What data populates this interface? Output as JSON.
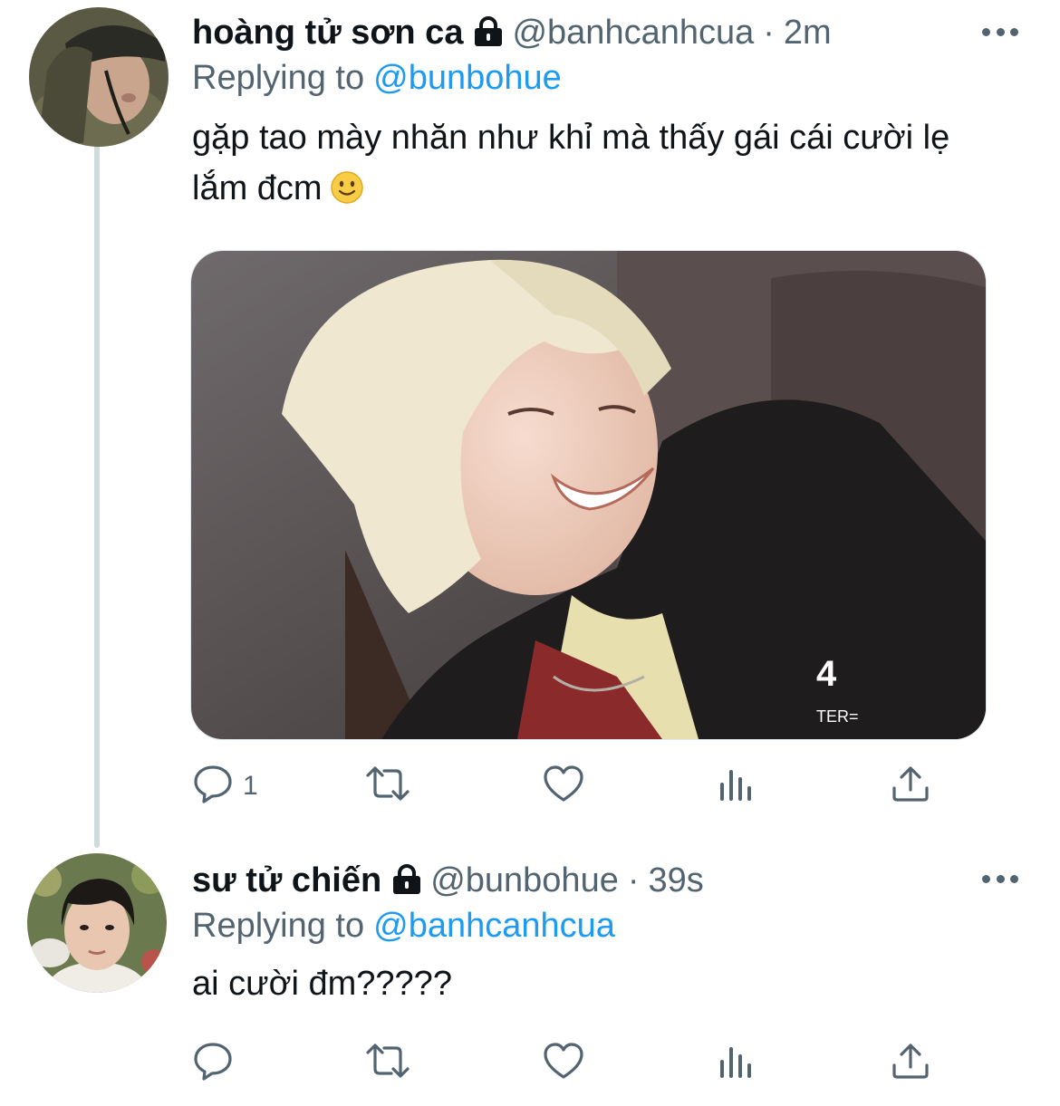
{
  "tweets": [
    {
      "name": "hoàng tử sơn ca",
      "handle": "@banhcanhcua",
      "separator": "·",
      "time": "2m",
      "replying_label": "Replying to",
      "replying_to": "@bunbohue",
      "text_line1": "gặp tao mày nhăn như khỉ mà thấy gái cái cười lẹ",
      "text_line2": "lắm đcm",
      "emoji": "slightly-smiling-face",
      "reply_count": "1"
    },
    {
      "name": "sư tử chiến",
      "handle": "@bunbohue",
      "separator": "·",
      "time": "39s",
      "replying_label": "Replying to",
      "replying_to": "@banhcanhcua",
      "text_line1": "ai cười đm?????",
      "reply_count": ""
    }
  ],
  "icons": {
    "lock": "lock-icon",
    "more": "more-icon",
    "reply": "reply-icon",
    "retweet": "retweet-icon",
    "like": "like-icon",
    "analytics": "analytics-icon",
    "share": "share-icon"
  },
  "colors": {
    "text": "#0f1419",
    "secondary": "#536471",
    "link": "#1d9bf0",
    "thread_line": "#cfd9de"
  }
}
